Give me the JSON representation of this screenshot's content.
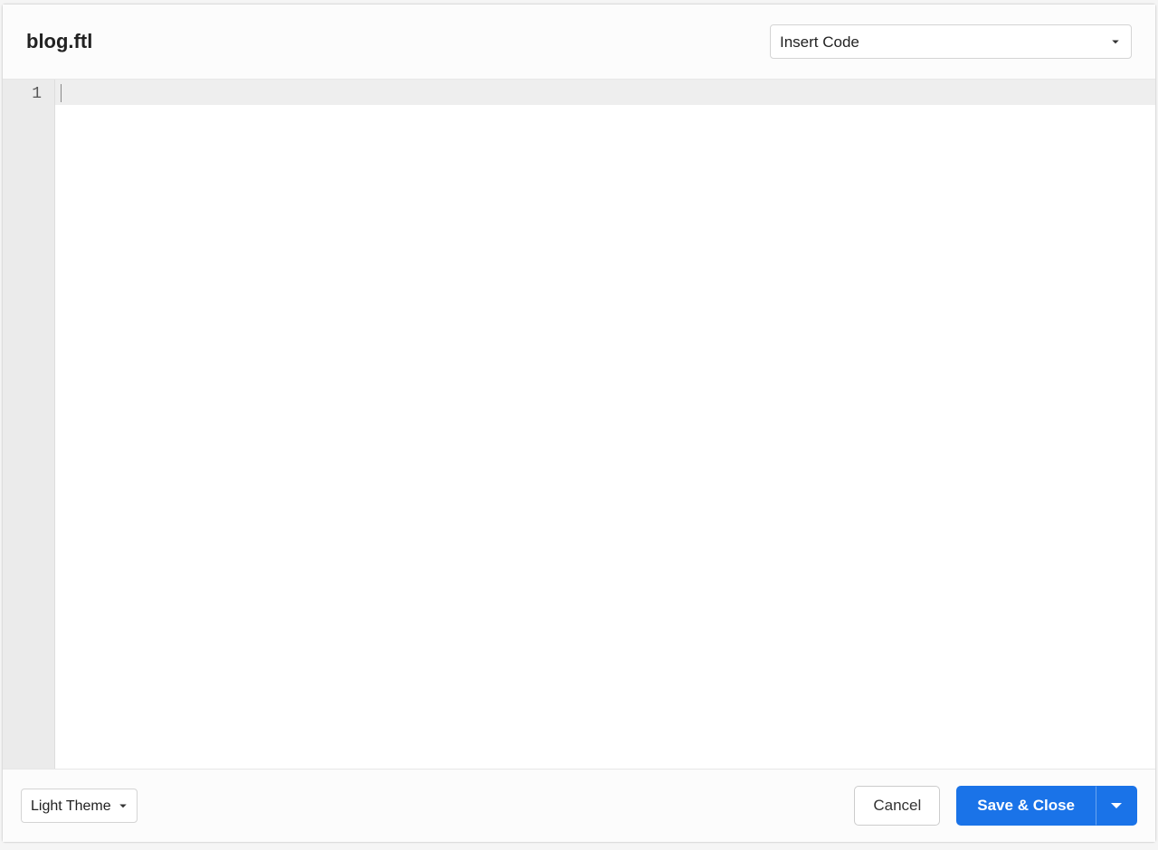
{
  "header": {
    "filename": "blog.ftl",
    "insert_code_label": "Insert Code"
  },
  "editor": {
    "line_numbers": [
      "1"
    ],
    "content": ""
  },
  "footer": {
    "theme_label": "Light Theme",
    "cancel_label": "Cancel",
    "save_label": "Save & Close"
  }
}
